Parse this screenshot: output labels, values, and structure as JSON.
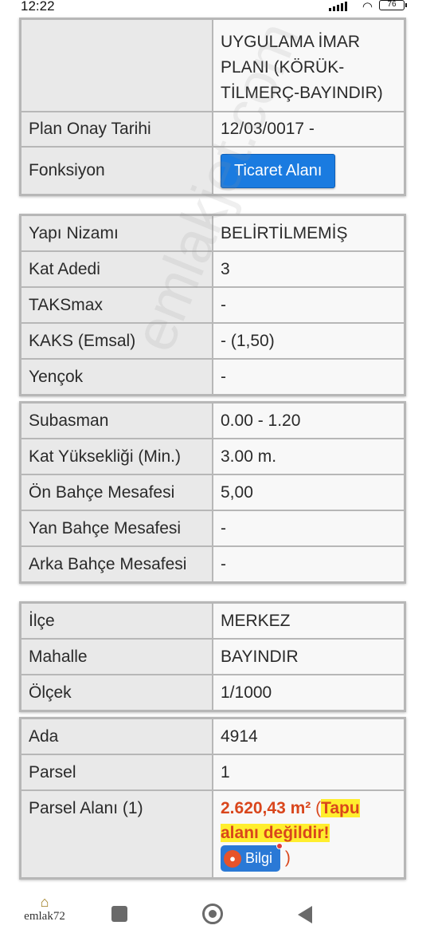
{
  "status_bar": {
    "time": "12:22",
    "battery": "76"
  },
  "plan_table": {
    "plan_name_value": "UYGULAMA İMAR PLANI (KÖRÜK-TİLMERÇ-BAYINDIR)",
    "rows": [
      {
        "label": "Plan Onay Tarihi",
        "value": "12/03/0017 -"
      },
      {
        "label": "Fonksiyon",
        "button": "Ticaret Alanı"
      }
    ]
  },
  "construction_table": {
    "rows": [
      {
        "label": "Yapı Nizamı",
        "value": "BELİRTİLMEMİŞ"
      },
      {
        "label": "Kat Adedi",
        "value": "3"
      },
      {
        "label": "TAKSmax",
        "value": "-"
      },
      {
        "label": "KAKS (Emsal)",
        "value": "- (1,50)"
      },
      {
        "label": "Yençok",
        "value": "-"
      }
    ]
  },
  "setback_table": {
    "rows": [
      {
        "label": "Subasman",
        "value": "0.00 - 1.20"
      },
      {
        "label": "Kat Yüksekliği (Min.)",
        "value": "3.00 m."
      },
      {
        "label": "Ön Bahçe Mesafesi",
        "value": "5,00"
      },
      {
        "label": "Yan Bahçe Mesafesi",
        "value": "-"
      },
      {
        "label": "Arka Bahçe Mesafesi",
        "value": "-"
      }
    ]
  },
  "location_table": {
    "rows": [
      {
        "label": "İlçe",
        "value": "MERKEZ"
      },
      {
        "label": "Mahalle",
        "value": "BAYINDIR"
      },
      {
        "label": "Ölçek",
        "value": "1/1000"
      }
    ]
  },
  "parcel_table": {
    "rows": [
      {
        "label": "Ada",
        "value": "4914"
      },
      {
        "label": "Parsel",
        "value": "1"
      }
    ],
    "area": {
      "label": "Parsel Alanı (1)",
      "value": "2.620,43 m²",
      "paren_open": " (",
      "warning_line1": "Tapu",
      "warning_line2": "alanı değildir!",
      "info_button": "Bilgi",
      "paren_close": " )"
    }
  },
  "watermark": "emlakjet.com",
  "nav_bar": {
    "logo_text": "emlak72"
  },
  "colors": {
    "button_blue": "#1a7be0",
    "warning_orange": "#d9461c",
    "highlight_yellow": "#ffee2e"
  }
}
